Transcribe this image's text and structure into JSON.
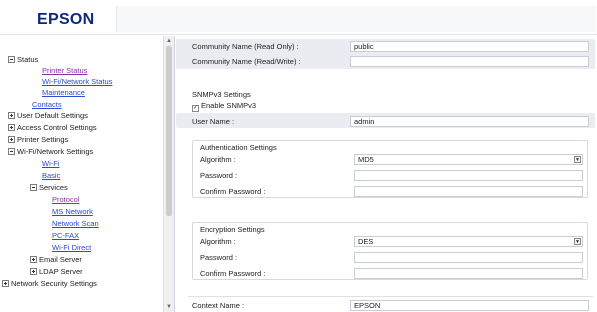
{
  "header": {
    "logo": "EPSON"
  },
  "sidebar": {
    "items": [
      {
        "label": "Status",
        "expander": "minus",
        "style": "text"
      },
      {
        "label": "Printer Status",
        "style": "link-visited"
      },
      {
        "label": "Wi-Fi/Network Status",
        "style": "link"
      },
      {
        "label": "Maintenance",
        "style": "link"
      },
      {
        "label": "Contacts",
        "style": "link"
      },
      {
        "label": "User Default Settings",
        "expander": "plus",
        "style": "text"
      },
      {
        "label": "Access Control Settings",
        "expander": "plus",
        "style": "text"
      },
      {
        "label": "Printer Settings",
        "expander": "plus",
        "style": "text"
      },
      {
        "label": "Wi-Fi/Network Settings",
        "expander": "minus",
        "style": "text"
      },
      {
        "label": "Wi-Fi",
        "style": "link"
      },
      {
        "label": "Basic",
        "style": "link"
      },
      {
        "label": "Services",
        "expander": "minus",
        "style": "text"
      },
      {
        "label": "Protocol",
        "style": "link-visited"
      },
      {
        "label": "MS Network",
        "style": "link"
      },
      {
        "label": "Network Scan",
        "style": "link"
      },
      {
        "label": "PC-FAX",
        "style": "link"
      },
      {
        "label": "Wi-Fi Direct",
        "style": "link"
      },
      {
        "label": "Email Server",
        "expander": "plus",
        "style": "text"
      },
      {
        "label": "LDAP Server",
        "expander": "plus",
        "style": "text"
      },
      {
        "label": "Network Security Settings",
        "expander": "plus",
        "style": "text"
      }
    ]
  },
  "main": {
    "community_read_only": {
      "label": "Community Name (Read Only) :",
      "value": "public"
    },
    "community_read_write": {
      "label": "Community Name (Read/Write) :",
      "value": ""
    },
    "snmpv3": {
      "title": "SNMPv3 Settings",
      "enable_label": "Enable SNMPv3",
      "enable_checked": true,
      "user_name": {
        "label": "User Name :",
        "value": "admin"
      },
      "authentication": {
        "title": "Authentication Settings",
        "algorithm": {
          "label": "Algorithm :",
          "value": "MD5"
        },
        "password": {
          "label": "Password :",
          "value": ""
        },
        "confirm": {
          "label": "Confirm Password :",
          "value": ""
        }
      },
      "encryption": {
        "title": "Encryption Settings",
        "algorithm": {
          "label": "Algorithm :",
          "value": "DES"
        },
        "password": {
          "label": "Password :",
          "value": ""
        },
        "confirm": {
          "label": "Confirm Password :",
          "value": ""
        }
      },
      "context_name": {
        "label": "Context Name :",
        "value": "EPSON"
      }
    }
  }
}
